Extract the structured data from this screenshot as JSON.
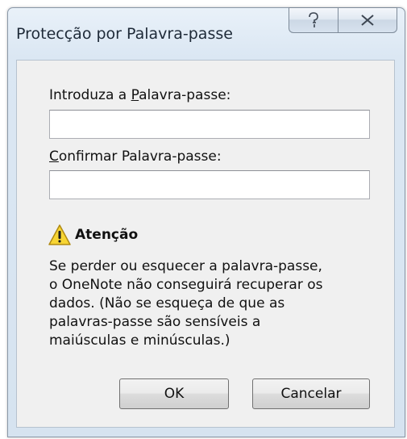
{
  "window": {
    "title": "Protecção por Palavra-passe"
  },
  "caption_buttons": {
    "help_glyph": "?",
    "help_icon": "help-icon",
    "close_icon": "close-icon"
  },
  "password": {
    "label_pre": "Introduza a ",
    "label_key": "P",
    "label_post": "alavra-passe:",
    "value": ""
  },
  "confirm": {
    "label_key": "C",
    "label_post": "onfirmar Palavra-passe:",
    "value": ""
  },
  "warning": {
    "icon": "warning-icon",
    "title": "Atenção",
    "lines": [
      "Se perder ou esquecer a palavra-passe,",
      "o OneNote não conseguirá recuperar os",
      "dados. (Não se esqueça de que as",
      "palavras-passe são sensíveis a",
      "maiúsculas e minúsculas.)"
    ]
  },
  "buttons": {
    "ok": "OK",
    "cancel": "Cancelar"
  },
  "colors": {
    "frame": "#dbe7f3",
    "client": "#f0f0f0",
    "warning_yellow": "#f7d533"
  }
}
